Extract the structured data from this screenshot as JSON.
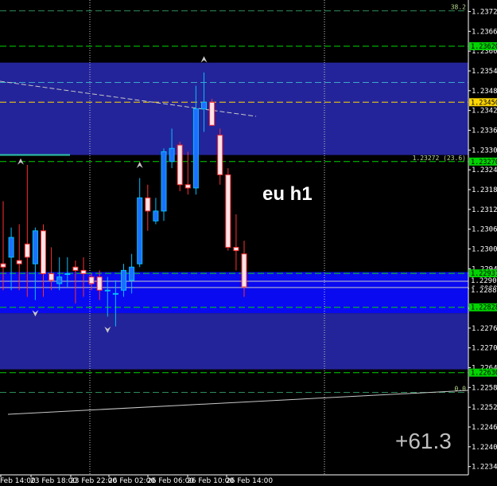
{
  "chart_data": {
    "type": "candlestick",
    "title": "eu h1",
    "readout": "+61.3",
    "ylim": [
      1.2232,
      1.2376
    ],
    "price_ticks": [
      "1.23725",
      "1.23665",
      "1.23605",
      "1.23545",
      "1.23485",
      "1.23425",
      "1.23365",
      "1.23305",
      "1.23245",
      "1.23185",
      "1.23125",
      "1.23065",
      "1.23005",
      "1.22945",
      "1.22885",
      "1.22825",
      "1.22765",
      "1.22705",
      "1.22645",
      "1.22585",
      "1.22525",
      "1.22465",
      "1.22405",
      "1.22345"
    ],
    "time_labels": [
      "Feb 14:00",
      "23 Feb 18:00",
      "23 Feb 22:00",
      "26 Feb 02:00",
      "26 Feb 06:00",
      "26 Feb 10:00",
      "26 Feb 14:00"
    ],
    "zones": [
      {
        "from": 1.2329,
        "to": 1.2357,
        "color": "#24249a"
      },
      {
        "from": 1.2281,
        "to": 1.22935,
        "color": "#0a0af0"
      },
      {
        "from": 1.2264,
        "to": 1.2281,
        "color": "#24249a"
      }
    ],
    "levels": [
      {
        "value": 1.23727,
        "color": "#2e8b57",
        "tag": "",
        "text": "38.2"
      },
      {
        "value": 1.2362,
        "color": "#00d400",
        "tag": "1.23620"
      },
      {
        "value": 1.2351,
        "color": "#3aa6c8"
      },
      {
        "value": 1.2345,
        "color": "#ffd700",
        "tag": "1.23450"
      },
      {
        "value": 1.2327,
        "color": "#00d400",
        "tag": "1.23270",
        "text": "1.23272 (23.6)"
      },
      {
        "value": 1.22931,
        "color": "#00d400",
        "tag": "1.22931"
      },
      {
        "value": 1.22828,
        "color": "#00d400",
        "tag": "1.22828"
      },
      {
        "value": 1.2263,
        "color": "#00d400",
        "tag": "1.22630"
      },
      {
        "value": 1.2257,
        "color": "#2e8b57",
        "text": "0.0"
      }
    ],
    "current_prices": [
      "1.22907",
      "1.22888"
    ],
    "candles": [
      {
        "o": 1.2296,
        "h": 1.2315,
        "l": 1.2288,
        "c": 1.2295
      },
      {
        "o": 1.2298,
        "h": 1.2307,
        "l": 1.2288,
        "c": 1.2304
      },
      {
        "o": 1.2297,
        "h": 1.2308,
        "l": 1.2288,
        "c": 1.2296
      },
      {
        "o": 1.2302,
        "h": 1.2326,
        "l": 1.2286,
        "c": 1.2298
      },
      {
        "o": 1.2296,
        "h": 1.2307,
        "l": 1.2285,
        "c": 1.2306
      },
      {
        "o": 1.2306,
        "h": 1.2308,
        "l": 1.2286,
        "c": 1.2293
      },
      {
        "o": 1.2293,
        "h": 1.2301,
        "l": 1.2288,
        "c": 1.2291
      },
      {
        "o": 1.229,
        "h": 1.2298,
        "l": 1.2288,
        "c": 1.2292
      },
      {
        "o": 1.2293,
        "h": 1.2298,
        "l": 1.2289,
        "c": 1.2293
      },
      {
        "o": 1.2295,
        "h": 1.2297,
        "l": 1.2284,
        "c": 1.2294
      },
      {
        "o": 1.2294,
        "h": 1.2298,
        "l": 1.2286,
        "c": 1.2293
      },
      {
        "o": 1.2292,
        "h": 1.2293,
        "l": 1.2288,
        "c": 1.229
      },
      {
        "o": 1.2292,
        "h": 1.2294,
        "l": 1.2285,
        "c": 1.2288
      },
      {
        "o": 1.2288,
        "h": 1.2292,
        "l": 1.228,
        "c": 1.2288
      },
      {
        "o": 1.2287,
        "h": 1.2291,
        "l": 1.2277,
        "c": 1.2287
      },
      {
        "o": 1.2288,
        "h": 1.2296,
        "l": 1.2286,
        "c": 1.2294
      },
      {
        "o": 1.2291,
        "h": 1.2299,
        "l": 1.2287,
        "c": 1.2295
      },
      {
        "o": 1.2296,
        "h": 1.2322,
        "l": 1.2295,
        "c": 1.2316
      },
      {
        "o": 1.2316,
        "h": 1.232,
        "l": 1.2306,
        "c": 1.2312
      },
      {
        "o": 1.2309,
        "h": 1.2316,
        "l": 1.2308,
        "c": 1.2312
      },
      {
        "o": 1.2312,
        "h": 1.2331,
        "l": 1.2309,
        "c": 1.233
      },
      {
        "o": 1.2327,
        "h": 1.2337,
        "l": 1.2325,
        "c": 1.2331
      },
      {
        "o": 1.2332,
        "h": 1.2333,
        "l": 1.2318,
        "c": 1.232
      },
      {
        "o": 1.232,
        "h": 1.233,
        "l": 1.2317,
        "c": 1.2319
      },
      {
        "o": 1.2319,
        "h": 1.235,
        "l": 1.2317,
        "c": 1.2343
      },
      {
        "o": 1.2343,
        "h": 1.2354,
        "l": 1.2336,
        "c": 1.2345
      },
      {
        "o": 1.2345,
        "h": 1.2346,
        "l": 1.2338,
        "c": 1.2338
      },
      {
        "o": 1.2335,
        "h": 1.2337,
        "l": 1.232,
        "c": 1.2323
      },
      {
        "o": 1.2323,
        "h": 1.2325,
        "l": 1.23,
        "c": 1.2301
      },
      {
        "o": 1.2301,
        "h": 1.2311,
        "l": 1.2294,
        "c": 1.23
      },
      {
        "o": 1.2299,
        "h": 1.2303,
        "l": 1.2286,
        "c": 1.2289
      }
    ]
  }
}
